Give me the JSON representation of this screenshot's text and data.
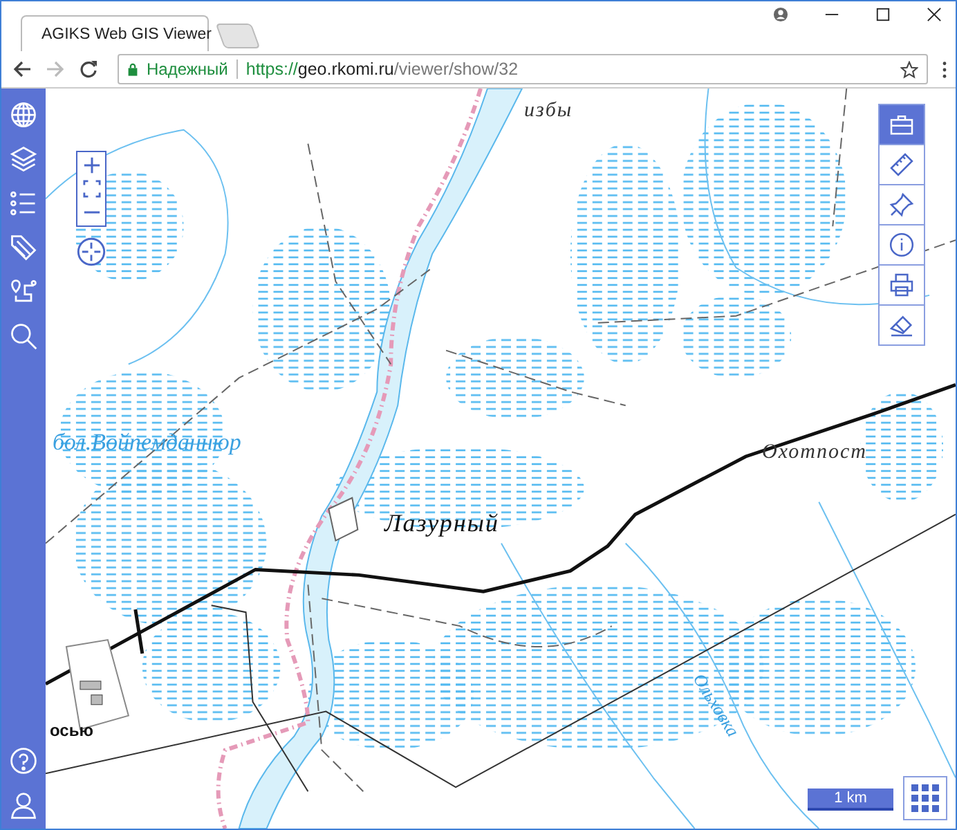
{
  "browser": {
    "tab_title": "AGIKS Web GIS Viewer",
    "security_label": "Надежный",
    "url_scheme": "https://",
    "url_host": "geo.rkomi.ru",
    "url_path": "/viewer/show/32"
  },
  "sidebar": {
    "top_tools": [
      {
        "kind": "globe"
      },
      {
        "kind": "layers"
      },
      {
        "kind": "legend"
      },
      {
        "kind": "tag"
      },
      {
        "kind": "route"
      },
      {
        "kind": "search"
      }
    ],
    "bottom_tools": [
      {
        "kind": "help"
      },
      {
        "kind": "user"
      }
    ]
  },
  "tool_panel": [
    {
      "kind": "toolbox",
      "selected": true
    },
    {
      "kind": "ruler",
      "selected": false
    },
    {
      "kind": "pin",
      "selected": false
    },
    {
      "kind": "info",
      "selected": false
    },
    {
      "kind": "print",
      "selected": false
    },
    {
      "kind": "eraser",
      "selected": false
    }
  ],
  "map_labels": [
    {
      "text": "избы",
      "kind": "settlement"
    },
    {
      "text": "бол.Войпемданнюр",
      "kind": "swamp"
    },
    {
      "text": "Лазурный",
      "kind": "village"
    },
    {
      "text": "Охотпост",
      "kind": "settlement"
    },
    {
      "text": "Ольховка",
      "kind": "river"
    },
    {
      "text": "осью",
      "kind": "road"
    }
  ],
  "scale": {
    "label": "1 km"
  }
}
